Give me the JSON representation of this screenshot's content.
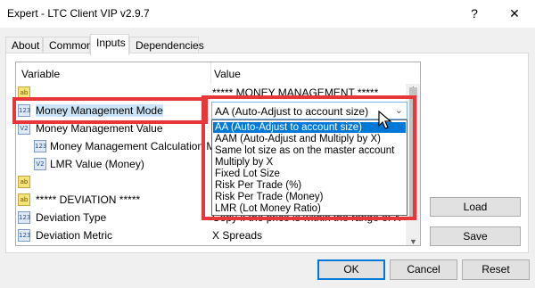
{
  "window": {
    "title": "Expert - LTC Client VIP v2.9.7",
    "help_glyph": "?",
    "close_glyph": "✕"
  },
  "tabs": [
    {
      "label": "About",
      "active": false
    },
    {
      "label": "Common",
      "active": false
    },
    {
      "label": "Inputs",
      "active": true
    },
    {
      "label": "Dependencies",
      "active": false
    }
  ],
  "grid": {
    "headers": {
      "variable": "Variable",
      "value": "Value"
    },
    "rows": [
      {
        "icon": "ab",
        "variable": "",
        "value": "***** MONEY MANAGEMENT *****"
      },
      {
        "icon": "123",
        "variable": "Money Management Mode",
        "value": ""
      },
      {
        "icon": "V2",
        "variable": "Money Management Value",
        "value": ""
      },
      {
        "icon": "123",
        "variable": "Money Management Calculation M...",
        "value": ""
      },
      {
        "icon": "V2",
        "variable": "LMR Value (Money)",
        "value": ""
      },
      {
        "icon": "ab",
        "variable": "",
        "value": ""
      },
      {
        "icon": "ab",
        "variable": "***** DEVIATION *****",
        "value": ""
      },
      {
        "icon": "123",
        "variable": "Deviation Type",
        "value": "Copy if the price is within the range of X"
      },
      {
        "icon": "123",
        "variable": "Deviation Metric",
        "value": "X Spreads"
      }
    ]
  },
  "combo": {
    "selected": "AA (Auto-Adjust to account size)",
    "arrow": "⌄"
  },
  "dropdown_options": [
    "AA (Auto-Adjust to account size)",
    "AAM (Auto-Adjust and Multiply by X)",
    "Same lot size as on the master account",
    "Multiply by X",
    "Fixed Lot Size",
    "Risk Per Trade (%)",
    "Risk Per Trade (Money)",
    "LMR (Lot Money Ratio)"
  ],
  "side_buttons": {
    "load": "Load",
    "save": "Save"
  },
  "buttons": {
    "ok": "OK",
    "cancel": "Cancel",
    "reset": "Reset"
  },
  "colors": {
    "highlight_red": "#e8373a",
    "selection_blue": "#0078d7",
    "selected_row": "#cce4f7"
  }
}
